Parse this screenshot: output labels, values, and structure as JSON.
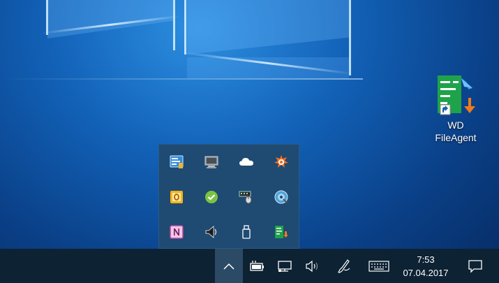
{
  "desktop": {
    "icon": {
      "name": "wd-fileagent-icon",
      "label_line1": "WD",
      "label_line2": "FileAgent"
    }
  },
  "tray_overflow": {
    "icons": [
      {
        "name": "network-settings-icon"
      },
      {
        "name": "display-monitor-icon"
      },
      {
        "name": "onedrive-cloud-icon"
      },
      {
        "name": "avast-icon"
      },
      {
        "name": "outlook-icon"
      },
      {
        "name": "skype-check-icon"
      },
      {
        "name": "keyboard-mouse-icon"
      },
      {
        "name": "disc-drive-icon"
      },
      {
        "name": "onenote-icon"
      },
      {
        "name": "speaker-icon"
      },
      {
        "name": "usb-drive-icon"
      },
      {
        "name": "wd-fileagent-tray-icon"
      }
    ]
  },
  "taskbar": {
    "clock_time": "7:53",
    "clock_date": "07.04.2017"
  },
  "colors": {
    "taskbar": "#0d2233",
    "tray_popup": "#1f4a72",
    "wd_green": "#1fa34a",
    "wd_orange": "#f07a1a"
  }
}
